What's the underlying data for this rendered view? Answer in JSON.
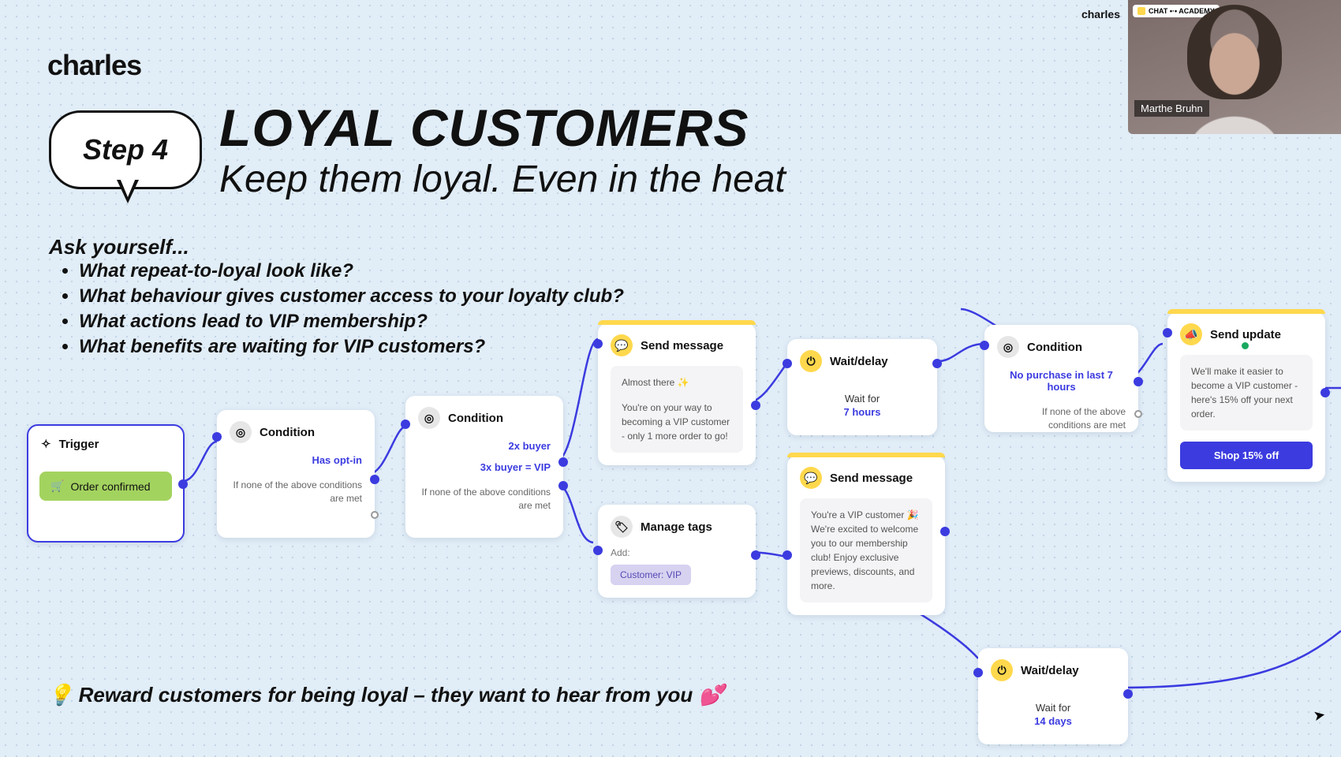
{
  "brand": "charles",
  "step_label": "Step 4",
  "title": "LOYAL CUSTOMERS",
  "subtitle": "Keep them loyal. Even in the heat",
  "ask_heading": "Ask yourself...",
  "bullets": [
    "What repeat-to-loyal look like?",
    "What behaviour gives customer access to your loyalty club?",
    "What actions lead to VIP membership?",
    "What benefits are waiting for VIP customers?"
  ],
  "tip": "💡 Reward customers  for being loyal – they want to hear from you 💕",
  "webcam": {
    "name": "Marthe Bruhn",
    "badge": "CHAT •·• ACADEMY",
    "watermark": "charles"
  },
  "flow": {
    "trigger": {
      "title": "Trigger",
      "pill": "Order confirmed"
    },
    "cond1": {
      "title": "Condition",
      "opt1": "Has opt-in",
      "fallback": "If none of the above conditions are met"
    },
    "cond2": {
      "title": "Condition",
      "opt1": "2x buyer",
      "opt2": "3x buyer = VIP",
      "fallback": "If none of the above conditions are met"
    },
    "msg1": {
      "title": "Send message",
      "line1": "Almost there ✨",
      "body": "You're on your way to becoming a VIP customer - only 1 more order to go!"
    },
    "managetags": {
      "title": "Manage tags",
      "add_label": "Add:",
      "chip": "Customer: VIP"
    },
    "msg2": {
      "title": "Send message",
      "body": "You're a VIP customer 🎉 We're excited to welcome you to our membership club! Enjoy exclusive previews, discounts, and more."
    },
    "wait1": {
      "title": "Wait/delay",
      "label": "Wait for",
      "value": "7 hours"
    },
    "cond3": {
      "title": "Condition",
      "opt1": "No purchase in last 7 hours",
      "fallback": "If none of the above conditions are met"
    },
    "update": {
      "title": "Send update",
      "body": "We'll make it easier to become a VIP customer - here's 15% off your next order.",
      "cta": "Shop 15% off"
    },
    "wait2": {
      "title": "Wait/delay",
      "label": "Wait for",
      "value": "14 days"
    }
  }
}
